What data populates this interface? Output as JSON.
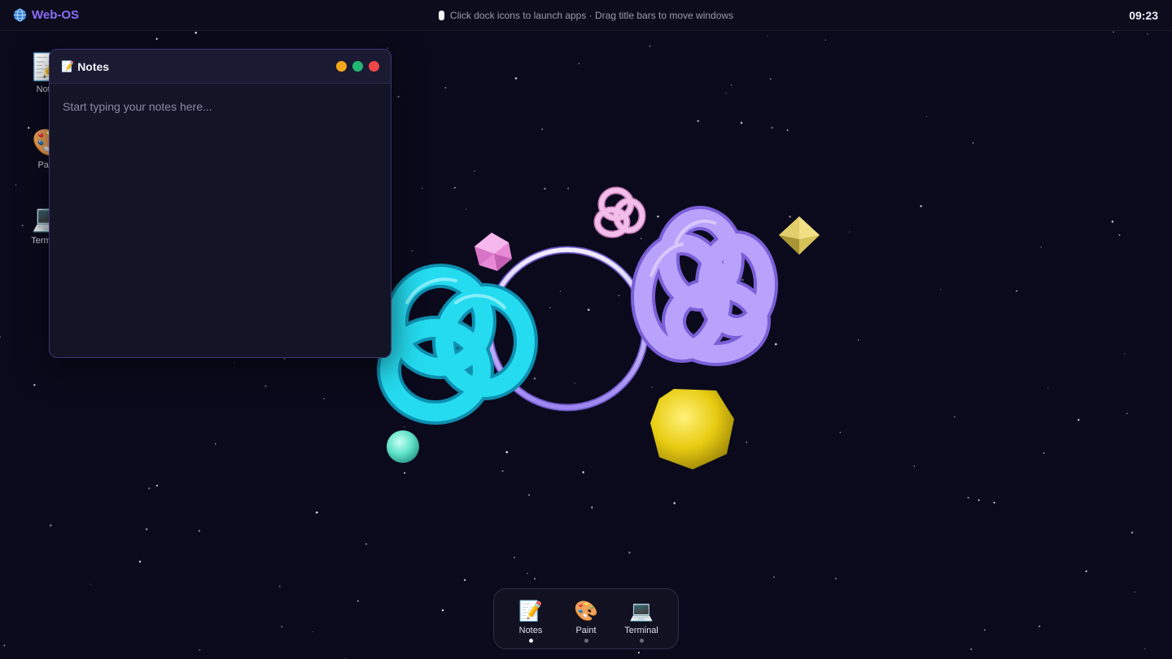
{
  "topbar": {
    "brand_icon": "globe-icon",
    "brand_name": "Web-OS",
    "hint_icon": "pill-icon",
    "hint": "Click dock icons to launch apps · Drag title bars to move windows",
    "clock": "09:23"
  },
  "desktop_icons": [
    {
      "id": "notes",
      "icon": "notepad-icon",
      "glyph": "📝",
      "label": "Notes"
    },
    {
      "id": "paint",
      "icon": "palette-icon",
      "glyph": "🎨",
      "label": "Paint"
    },
    {
      "id": "terminal",
      "icon": "laptop-icon",
      "glyph": "💻",
      "label": "Terminal"
    }
  ],
  "notes_window": {
    "title_icon": "notepad-icon",
    "title_glyph": "📝",
    "title": "Notes",
    "placeholder": "Start typing your notes here...",
    "value": "",
    "controls": [
      "minimize",
      "maximize",
      "close"
    ]
  },
  "dock": {
    "items": [
      {
        "id": "notes",
        "icon": "notepad-icon",
        "glyph": "📝",
        "label": "Notes",
        "active": true
      },
      {
        "id": "paint",
        "icon": "palette-icon",
        "glyph": "🎨",
        "label": "Paint",
        "active": false
      },
      {
        "id": "terminal",
        "icon": "laptop-icon",
        "glyph": "💻",
        "label": "Terminal",
        "active": false
      }
    ]
  },
  "scene": {
    "objects": [
      "cyan-torus-knot",
      "lavender-ring",
      "pink-icosahedron",
      "pink-small-torus-knot",
      "lavender-torus-knot",
      "yellow-octahedron",
      "yellow-sphere",
      "mint-sphere"
    ],
    "colors": {
      "background": "#0a0a1c",
      "accent": "#8b6cf6",
      "cyan": "#22d3ee",
      "lavender": "#a78bfa",
      "pink": "#f0abfc",
      "yellow": "#fde047",
      "mint": "#5eead4"
    }
  }
}
